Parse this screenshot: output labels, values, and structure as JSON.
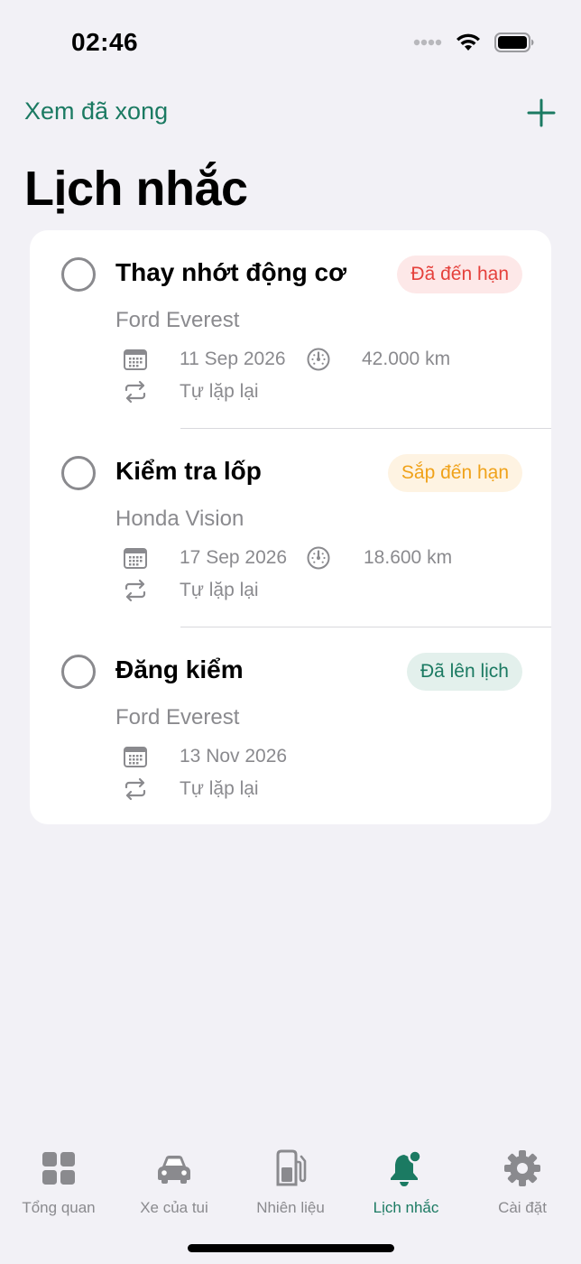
{
  "status": {
    "time": "02:46",
    "icons": [
      "signal-dots-icon",
      "wifi-icon",
      "battery-icon"
    ]
  },
  "nav": {
    "left_action": "Xem đã xong",
    "add_icon": "plus-icon",
    "title": "Lịch nhắc"
  },
  "colors": {
    "accent": "#1b7a62",
    "background": "#f2f1f6",
    "badge_due_bg": "#fde8e8",
    "badge_due_fg": "#e5403b",
    "badge_soon_bg": "#fef3e2",
    "badge_soon_fg": "#f0a21a",
    "badge_scheduled_bg": "#e3f0ec",
    "badge_scheduled_fg": "#1b7a62"
  },
  "reminders": [
    {
      "title": "Thay nhớt động cơ",
      "status": "Đã đến hạn",
      "vehicle": "Ford Everest",
      "date": "11 Sep 2026",
      "odometer": "42.000 km",
      "repeat": "Tự lặp lại"
    },
    {
      "title": "Kiểm tra lốp",
      "status": "Sắp đến hạn",
      "vehicle": "Honda Vision",
      "date": "17 Sep 2026",
      "odometer": "18.600 km",
      "repeat": "Tự lặp lại"
    },
    {
      "title": "Đăng kiểm",
      "status": "Đã lên lịch",
      "vehicle": "Ford Everest",
      "date": "13 Nov 2026",
      "repeat": "Tự lặp lại"
    }
  ],
  "tabs": [
    {
      "label": "Tổng quan",
      "icon": "grid-icon"
    },
    {
      "label": "Xe của tui",
      "icon": "car-icon"
    },
    {
      "label": "Nhiên liệu",
      "icon": "fuel-pump-icon"
    },
    {
      "label": "Lịch nhắc",
      "icon": "bell-badge-icon",
      "active": true
    },
    {
      "label": "Cài đặt",
      "icon": "gear-icon"
    }
  ]
}
